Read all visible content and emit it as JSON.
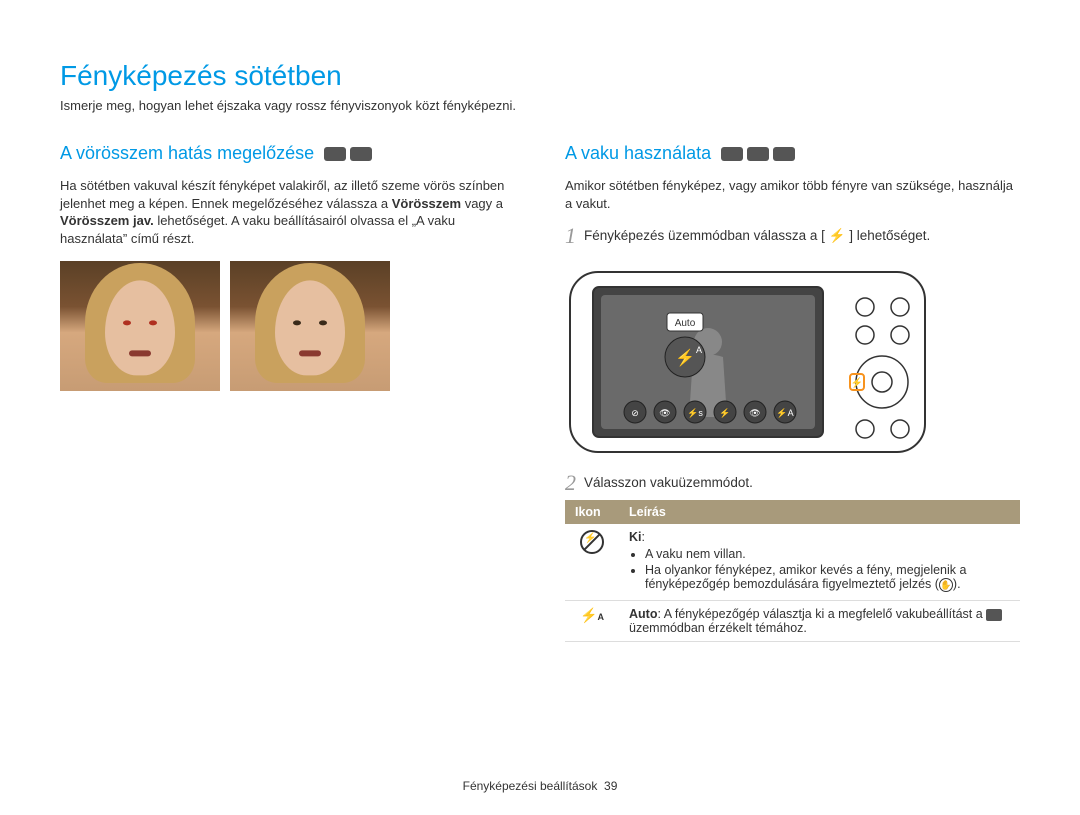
{
  "page_title": "Fényképezés sötétben",
  "intro": "Ismerje meg, hogyan lehet éjszaka vagy rossz fényviszonyok közt fényképezni.",
  "left": {
    "heading": "A vörösszem hatás megelőzése",
    "body1": "Ha sötétben vakuval készít fényképet valakiről, az illető szeme vörös színben jelenhet meg a képen. Ennek megelőzéséhez válassza a ",
    "bold1": "Vörösszem",
    "body2": " vagy a ",
    "bold2": "Vörösszem jav.",
    "body3": " lehetőséget. A vaku beállításairól olvassa el „A vaku használata” című részt."
  },
  "right": {
    "heading": "A vaku használata",
    "body": "Amikor sötétben fényképez, vagy amikor több fényre van szüksége, használja a vakut.",
    "step1_a": "Fényképezés üzemmódban válassza a [",
    "step1_b": "] lehetőséget.",
    "camera_tooltip": "Auto",
    "step2": "Válasszon vakuüzemmódot.",
    "table": {
      "th_icon": "Ikon",
      "th_desc": "Leírás",
      "rows": [
        {
          "label": "Ki",
          "bullet1": "A vaku nem villan.",
          "bullet2": "Ha olyankor fényképez, amikor kevés a fény, megjelenik a fényképezőgép bemozdulására figyelmeztető jelzés ("
        },
        {
          "auto_strong": "Auto",
          "auto_rest": ": A fényképezőgép választja ki a megfelelő vakubeállítást a ",
          "auto_rest2": " üzemmódban érzékelt témához."
        }
      ]
    }
  },
  "footer_text": "Fényképezési beállítások",
  "footer_page": "39"
}
